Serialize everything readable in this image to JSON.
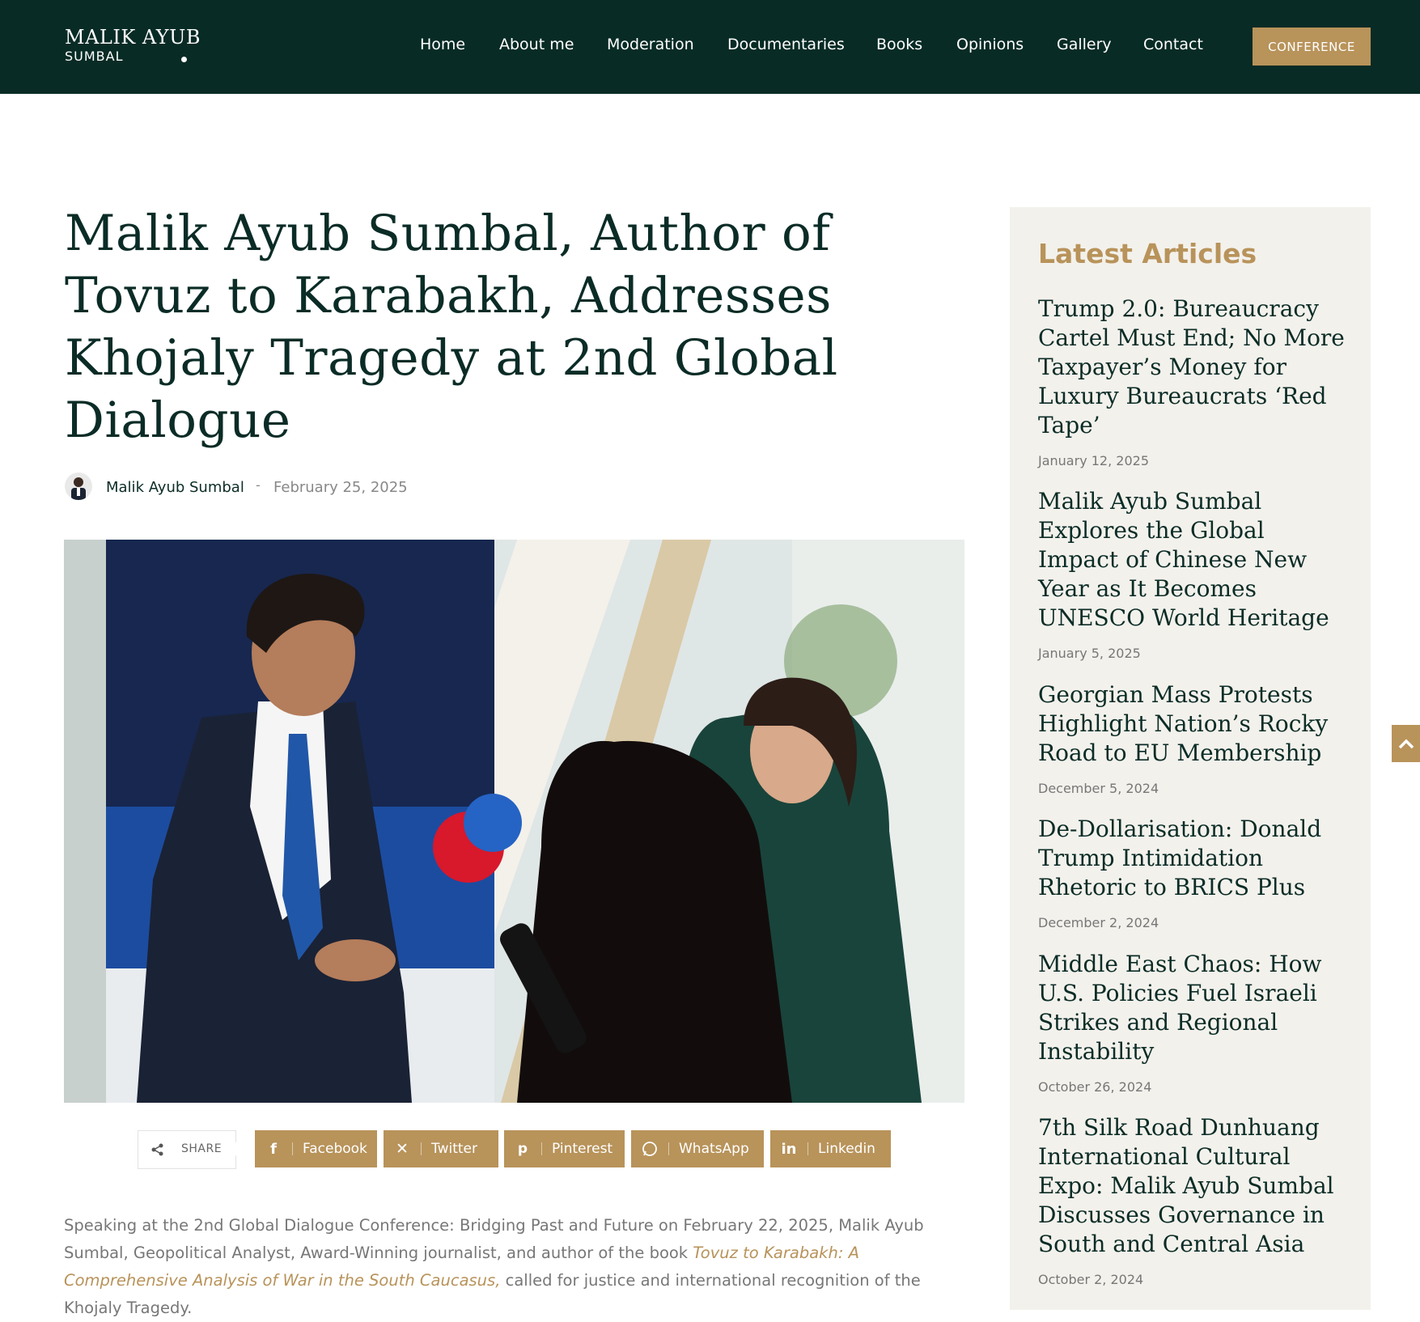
{
  "header": {
    "logo_line1": "MALIK AYUB",
    "logo_line2": "SUMBAL",
    "nav": [
      "Home",
      "About me",
      "Moderation",
      "Documentaries",
      "Books",
      "Opinions",
      "Gallery",
      "Contact"
    ],
    "cta_label": "CONFERENCE"
  },
  "article": {
    "title": "Malik Ayub Sumbal, Author of Tovuz to Karabakh, Addresses Khojaly Tragedy at 2nd Global Dialogue",
    "author": "Malik Ayub Sumbal",
    "separator": "-",
    "date": "February 25, 2025",
    "body_intro": "Speaking at the 2nd Global Dialogue Conference: Bridging Past and Future on February 22, 2025, Malik Ayub Sumbal, Geopolitical Analyst, Award-Winning journalist, and author of the book ",
    "body_link": "Tovuz to Karabakh: A Comprehensive Analysis of War in the South Caucasus,",
    "body_outro": " called for justice and international recognition of the Khojaly Tragedy."
  },
  "share": {
    "label": "SHARE",
    "buttons": [
      "Facebook",
      "Twitter",
      "Pinterest",
      "WhatsApp",
      "Linkedin"
    ]
  },
  "sidebar": {
    "heading": "Latest Articles",
    "articles": [
      {
        "title": "Trump 2.0: Bureaucracy Cartel Must End; No More Taxpayer’s Money for Luxury Bureaucrats ‘Red Tape’",
        "date": "January 12, 2025"
      },
      {
        "title": "Malik Ayub Sumbal Explores the Global Impact of Chinese New Year as It Becomes UNESCO World Heritage",
        "date": "January 5, 2025"
      },
      {
        "title": "Georgian Mass Protests Highlight Nation’s Rocky Road to EU Membership",
        "date": "December 5, 2024"
      },
      {
        "title": "De-Dollarisation: Donald Trump Intimidation Rhetoric to BRICS Plus",
        "date": "December 2, 2024"
      },
      {
        "title": "Middle East Chaos: How U.S. Policies Fuel Israeli Strikes and Regional Instability",
        "date": "October 26, 2024"
      },
      {
        "title": "7th Silk Road Dunhuang International Cultural Expo: Malik Ayub Sumbal Discusses Governance in South and Central Asia",
        "date": "October 2, 2024"
      }
    ]
  },
  "colors": {
    "header_bg": "#082b25",
    "accent": "#b8935a",
    "title_text": "#0b2c26",
    "sidebar_bg": "#f3f1ec"
  }
}
